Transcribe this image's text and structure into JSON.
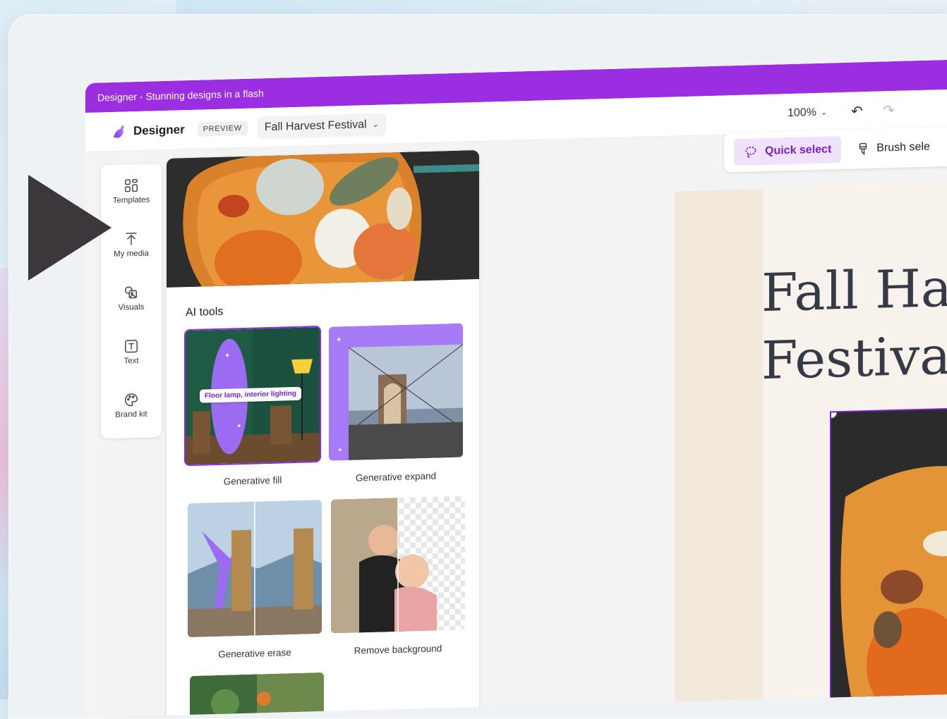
{
  "window": {
    "title": "Designer - Stunning designs in a flash"
  },
  "appbar": {
    "brand": "Designer",
    "preview_tag": "PREVIEW",
    "document_title": "Fall Harvest Festival",
    "zoom": "100%"
  },
  "rail": {
    "items": [
      {
        "label": "Templates",
        "icon": "templates-icon"
      },
      {
        "label": "My media",
        "icon": "upload-icon"
      },
      {
        "label": "Visuals",
        "icon": "visuals-icon"
      },
      {
        "label": "Text",
        "icon": "text-icon"
      },
      {
        "label": "Brand kit",
        "icon": "palette-icon"
      }
    ]
  },
  "panel": {
    "section_title": "AI tools",
    "fill_prompt": "Floor lamp, interior lighting",
    "tools": [
      {
        "label": "Generative fill"
      },
      {
        "label": "Generative expand"
      },
      {
        "label": "Generative erase"
      },
      {
        "label": "Remove background"
      }
    ]
  },
  "toolbar": {
    "quick_select": "Quick select",
    "brush_select": "Brush sele"
  },
  "canvas": {
    "headline": "Fall Ha\nFestiva"
  },
  "colors": {
    "title_bar": "#9a2ee0",
    "accent": "#7a1fc9",
    "selected_tab_bg": "#efe3fb"
  }
}
